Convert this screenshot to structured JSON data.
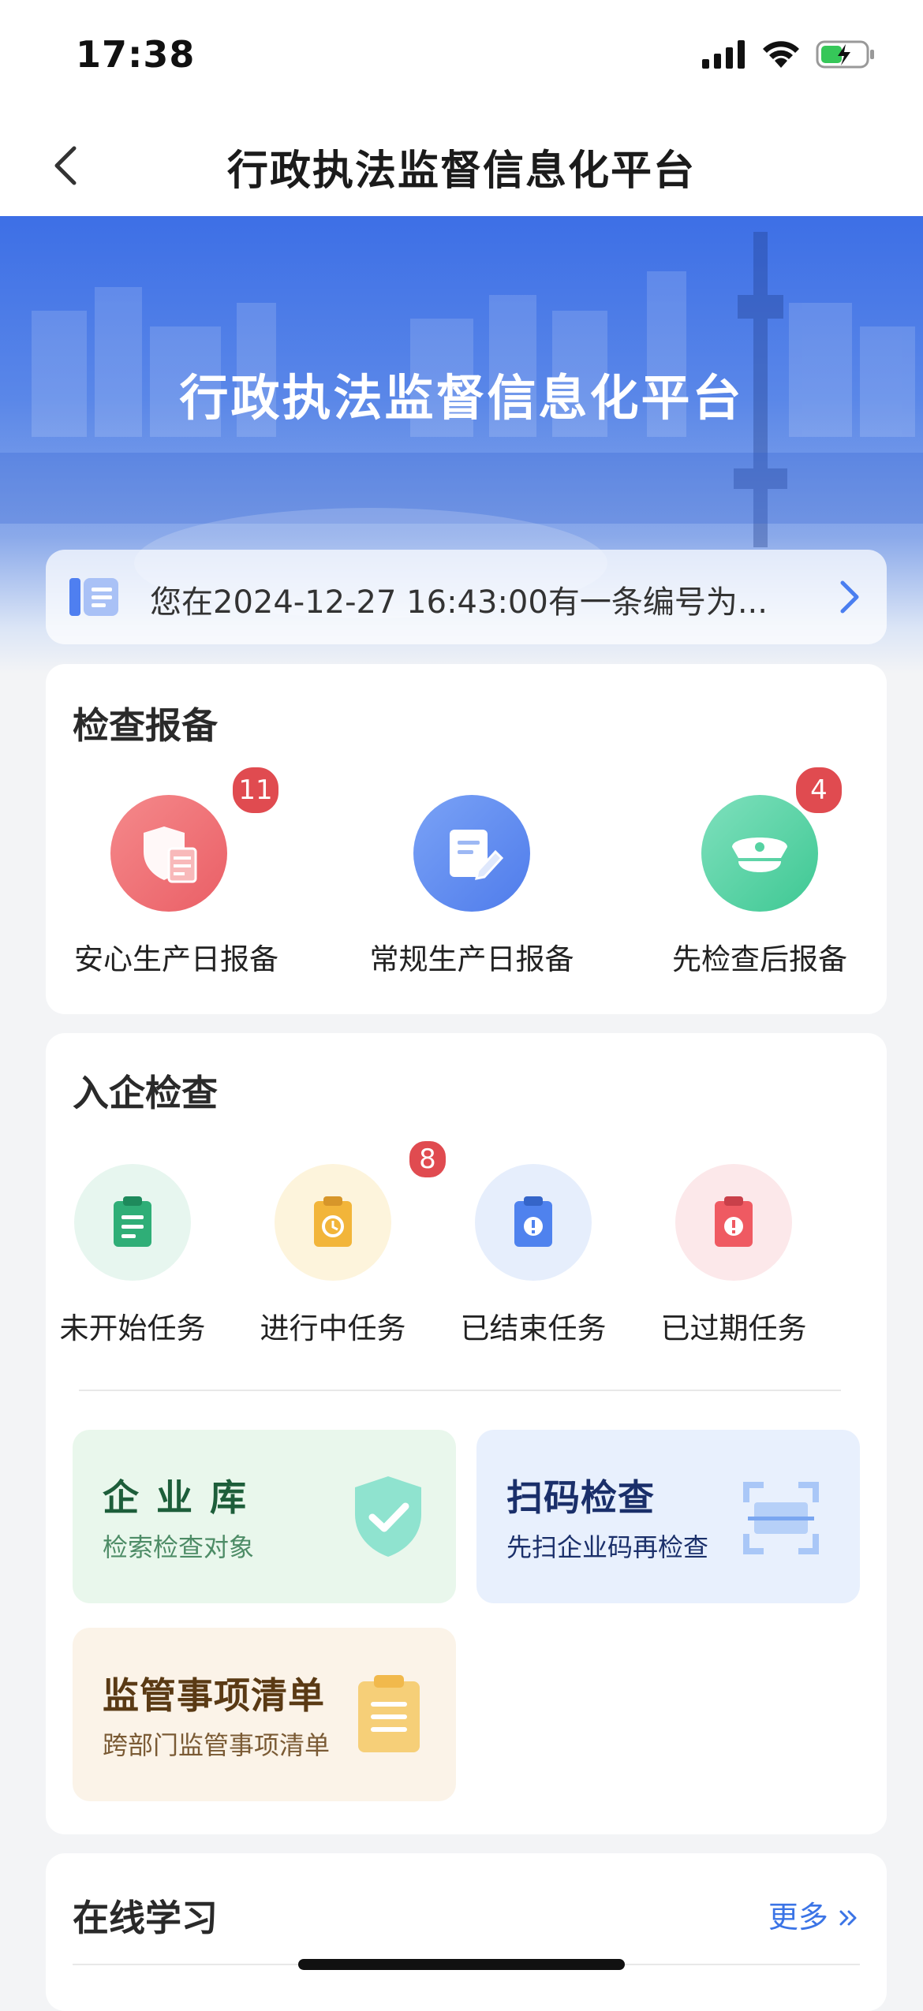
{
  "status": {
    "time": "17:38"
  },
  "nav": {
    "title": "行政执法监督信息化平台"
  },
  "banner": {
    "title": "行政执法监督信息化平台"
  },
  "notice": {
    "text": "您在2024-12-27 16:43:00有一条编号为..."
  },
  "inspection_report": {
    "title": "检查报备",
    "items": [
      {
        "label": "安心生产日报备",
        "badge": "11",
        "color": "#ef6f74"
      },
      {
        "label": "常规生产日报备",
        "badge": "",
        "color": "#5f8cf0"
      },
      {
        "label": "先检查后报备",
        "badge": "4",
        "color": "#4fd3a1"
      }
    ]
  },
  "enterprise_check": {
    "title": "入企检查",
    "tasks": [
      {
        "label": "未开始任务",
        "badge": "",
        "color": "#2fae77",
        "bg": "#e7f6ef"
      },
      {
        "label": "进行中任务",
        "badge": "8",
        "color": "#f2b53a",
        "bg": "#fdf4dc"
      },
      {
        "label": "已结束任务",
        "badge": "",
        "color": "#4f82ee",
        "bg": "#e6eefc"
      },
      {
        "label": "已过期任务",
        "badge": "",
        "color": "#ef5a62",
        "bg": "#fce8ea"
      }
    ],
    "tiles": {
      "library": {
        "title": "企 业 库",
        "subtitle": "检索检查对象"
      },
      "scan": {
        "title": "扫码检查",
        "subtitle": "先扫企业码再检查"
      },
      "checklist": {
        "title": "监管事项清单",
        "subtitle": "跨部门监管事项清单"
      }
    }
  },
  "online_learning": {
    "title": "在线学习",
    "more": "更多"
  }
}
